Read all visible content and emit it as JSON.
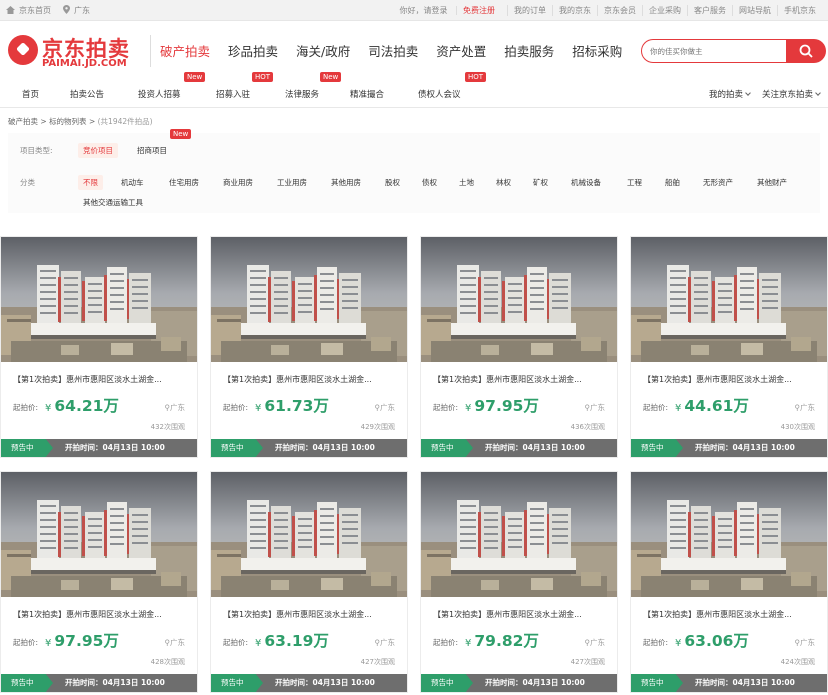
{
  "topbar": {
    "home": "京东首页",
    "location": "广东",
    "greeting": "你好，请登录",
    "register": "免费注册",
    "links": [
      "我的订单",
      "我的京东",
      "京东会员",
      "企业采购",
      "客户服务",
      "网站导航",
      "手机京东"
    ]
  },
  "logo": {
    "cn": "京东拍卖",
    "en": "PAIMAI.JD.COM"
  },
  "mainnav": [
    "破产拍卖",
    "珍品拍卖",
    "海关/政府",
    "司法拍卖",
    "资产处置",
    "拍卖服务",
    "招标采购"
  ],
  "search": {
    "placeholder": "你的佳买你做主"
  },
  "subnav": {
    "items": [
      "首页",
      "拍卖公告",
      "投资人招募",
      "招募入驻",
      "法律服务",
      "精准撮合",
      "债权人会议"
    ],
    "badges": {
      "investor": "New",
      "settle": "HOT",
      "legal": "New",
      "creditor": "HOT"
    },
    "right": [
      "我的拍卖",
      "关注京东拍卖"
    ]
  },
  "breadcrumb": {
    "parts": [
      "破产拍卖",
      "标的物列表"
    ],
    "count": "(共1942件拍品)"
  },
  "filter": {
    "type_label": "项目类型:",
    "types": [
      "竞价项目",
      "招商项目"
    ],
    "type_badge": "New",
    "cat_label": "分类",
    "categories": [
      "不限",
      "机动车",
      "住宅用房",
      "商业用房",
      "工业用房",
      "其他用房",
      "股权",
      "债权",
      "土地",
      "林权",
      "矿权",
      "机械设备",
      "工程",
      "船舶",
      "无形资产",
      "其他财产",
      "其他交通运输工具"
    ]
  },
  "listing": {
    "price_label": "起拍价:",
    "currency": "¥",
    "status": "预告中",
    "start_time": "开拍时间：04月13日 10:00",
    "cards": [
      {
        "title": "【第1次拍卖】惠州市惠阳区淡水土湖金...",
        "price": "64.21万",
        "location": "广东",
        "views": "432次围观"
      },
      {
        "title": "【第1次拍卖】惠州市惠阳区淡水土湖金...",
        "price": "61.73万",
        "location": "广东",
        "views": "429次围观"
      },
      {
        "title": "【第1次拍卖】惠州市惠阳区淡水土湖金...",
        "price": "97.95万",
        "location": "广东",
        "views": "436次围观"
      },
      {
        "title": "【第1次拍卖】惠州市惠阳区淡水土湖金...",
        "price": "44.61万",
        "location": "广东",
        "views": "430次围观"
      },
      {
        "title": "【第1次拍卖】惠州市惠阳区淡水土湖金...",
        "price": "97.95万",
        "location": "广东",
        "views": "428次围观"
      },
      {
        "title": "【第1次拍卖】惠州市惠阳区淡水土湖金...",
        "price": "63.19万",
        "location": "广东",
        "views": "427次围观"
      },
      {
        "title": "【第1次拍卖】惠州市惠阳区淡水土湖金...",
        "price": "79.82万",
        "location": "广东",
        "views": "427次围观"
      },
      {
        "title": "【第1次拍卖】惠州市惠阳区淡水土湖金...",
        "price": "63.06万",
        "location": "广东",
        "views": "424次围观"
      }
    ]
  },
  "colors": {
    "brand_red": "#e4393c",
    "price_green": "#2e9e6a",
    "footer_gray": "#6e6e6e"
  },
  "icons": [
    "home-icon",
    "location-pin-icon",
    "search-icon",
    "chevron-down-icon"
  ]
}
